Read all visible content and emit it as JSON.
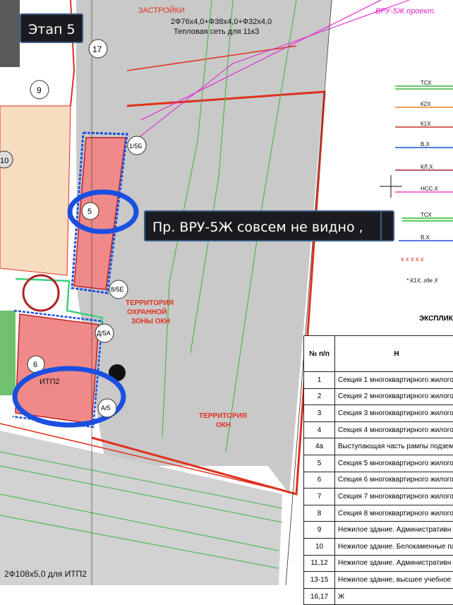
{
  "overlay": {
    "stage_label": "Этап 5",
    "comment": "Пр. ВРУ-5Ж совсем не видно ,"
  },
  "map_labels": {
    "pipe_top": "2Ф76х4,0+Ф38х4,0+Ф32х4,0",
    "heat_network": "Тепловая сеть для 11кЗ",
    "vru_project": "ВРУ-5Ж проект.",
    "pipe_bottom": "2Ф108х5,0 для ИТП2",
    "itp": "ИТП2",
    "territory_1": "ТЕРРИТОРИЯ",
    "territory_2": "ОХРАННОЙ",
    "territory_3": "ЗОНЫ ОКН",
    "territory_b1": "ТЕРРИТОРИЯ",
    "territory_b2": "ОКН",
    "zastroyki": "ЗАСТРОЙКИ",
    "block_9": "9",
    "block_17": "17",
    "block_10": "10",
    "block_5": "5",
    "block_6": "6",
    "tag_1_5b": "1/5Б",
    "tag_8_5e": "8/5Е",
    "tag_d_5a": "Д/5А",
    "tag_a_5": "А/5"
  },
  "legend": {
    "lines": [
      "ТСХ",
      "К2Х",
      "К1Х",
      "В.Х",
      "КЛ.Х",
      "НСС.Х",
      "ТСХ",
      "В.Х"
    ],
    "note": "* К1Х, где Х",
    "title": "ЭКСПЛИК"
  },
  "table": {
    "header_num": "№ п/п",
    "header_name": "Н",
    "rows": [
      {
        "num": "1",
        "desc": "Секция 1 многоквартирного жилого"
      },
      {
        "num": "2",
        "desc": "Секция 2 многоквартирного жилого"
      },
      {
        "num": "3",
        "desc": "Секция 3 многоквартирного жилого"
      },
      {
        "num": "4",
        "desc": "Секция 4 многоквартирного жилого"
      },
      {
        "num": "4а",
        "desc": "Выступающая часть рампы подзем"
      },
      {
        "num": "5",
        "desc": "Секция 5 многоквартирного жилого"
      },
      {
        "num": "6",
        "desc": "Секция 6 многоквартирного жилого"
      },
      {
        "num": "7",
        "desc": "Секция 7 многоквартирного жилого"
      },
      {
        "num": "8",
        "desc": "Секция 8 многоквартирного жилого"
      },
      {
        "num": "9",
        "desc": "Нежилое здание. Административн"
      },
      {
        "num": "10",
        "desc": "Нежилое здание. Белокаменные па"
      },
      {
        "num": "11,12",
        "desc": "Нежилое здание. Административн"
      },
      {
        "num": "13-15",
        "desc": "Нежилое здание, высшее учебное з"
      },
      {
        "num": "16,17",
        "desc": "Ж"
      }
    ]
  },
  "colors": {
    "pink_building": "#f08a8a",
    "green_zone": "#6fc06f",
    "gray_area": "#c8c8c8",
    "blue_highlight": "#1a4fe0",
    "red_line": "#e0301e"
  }
}
